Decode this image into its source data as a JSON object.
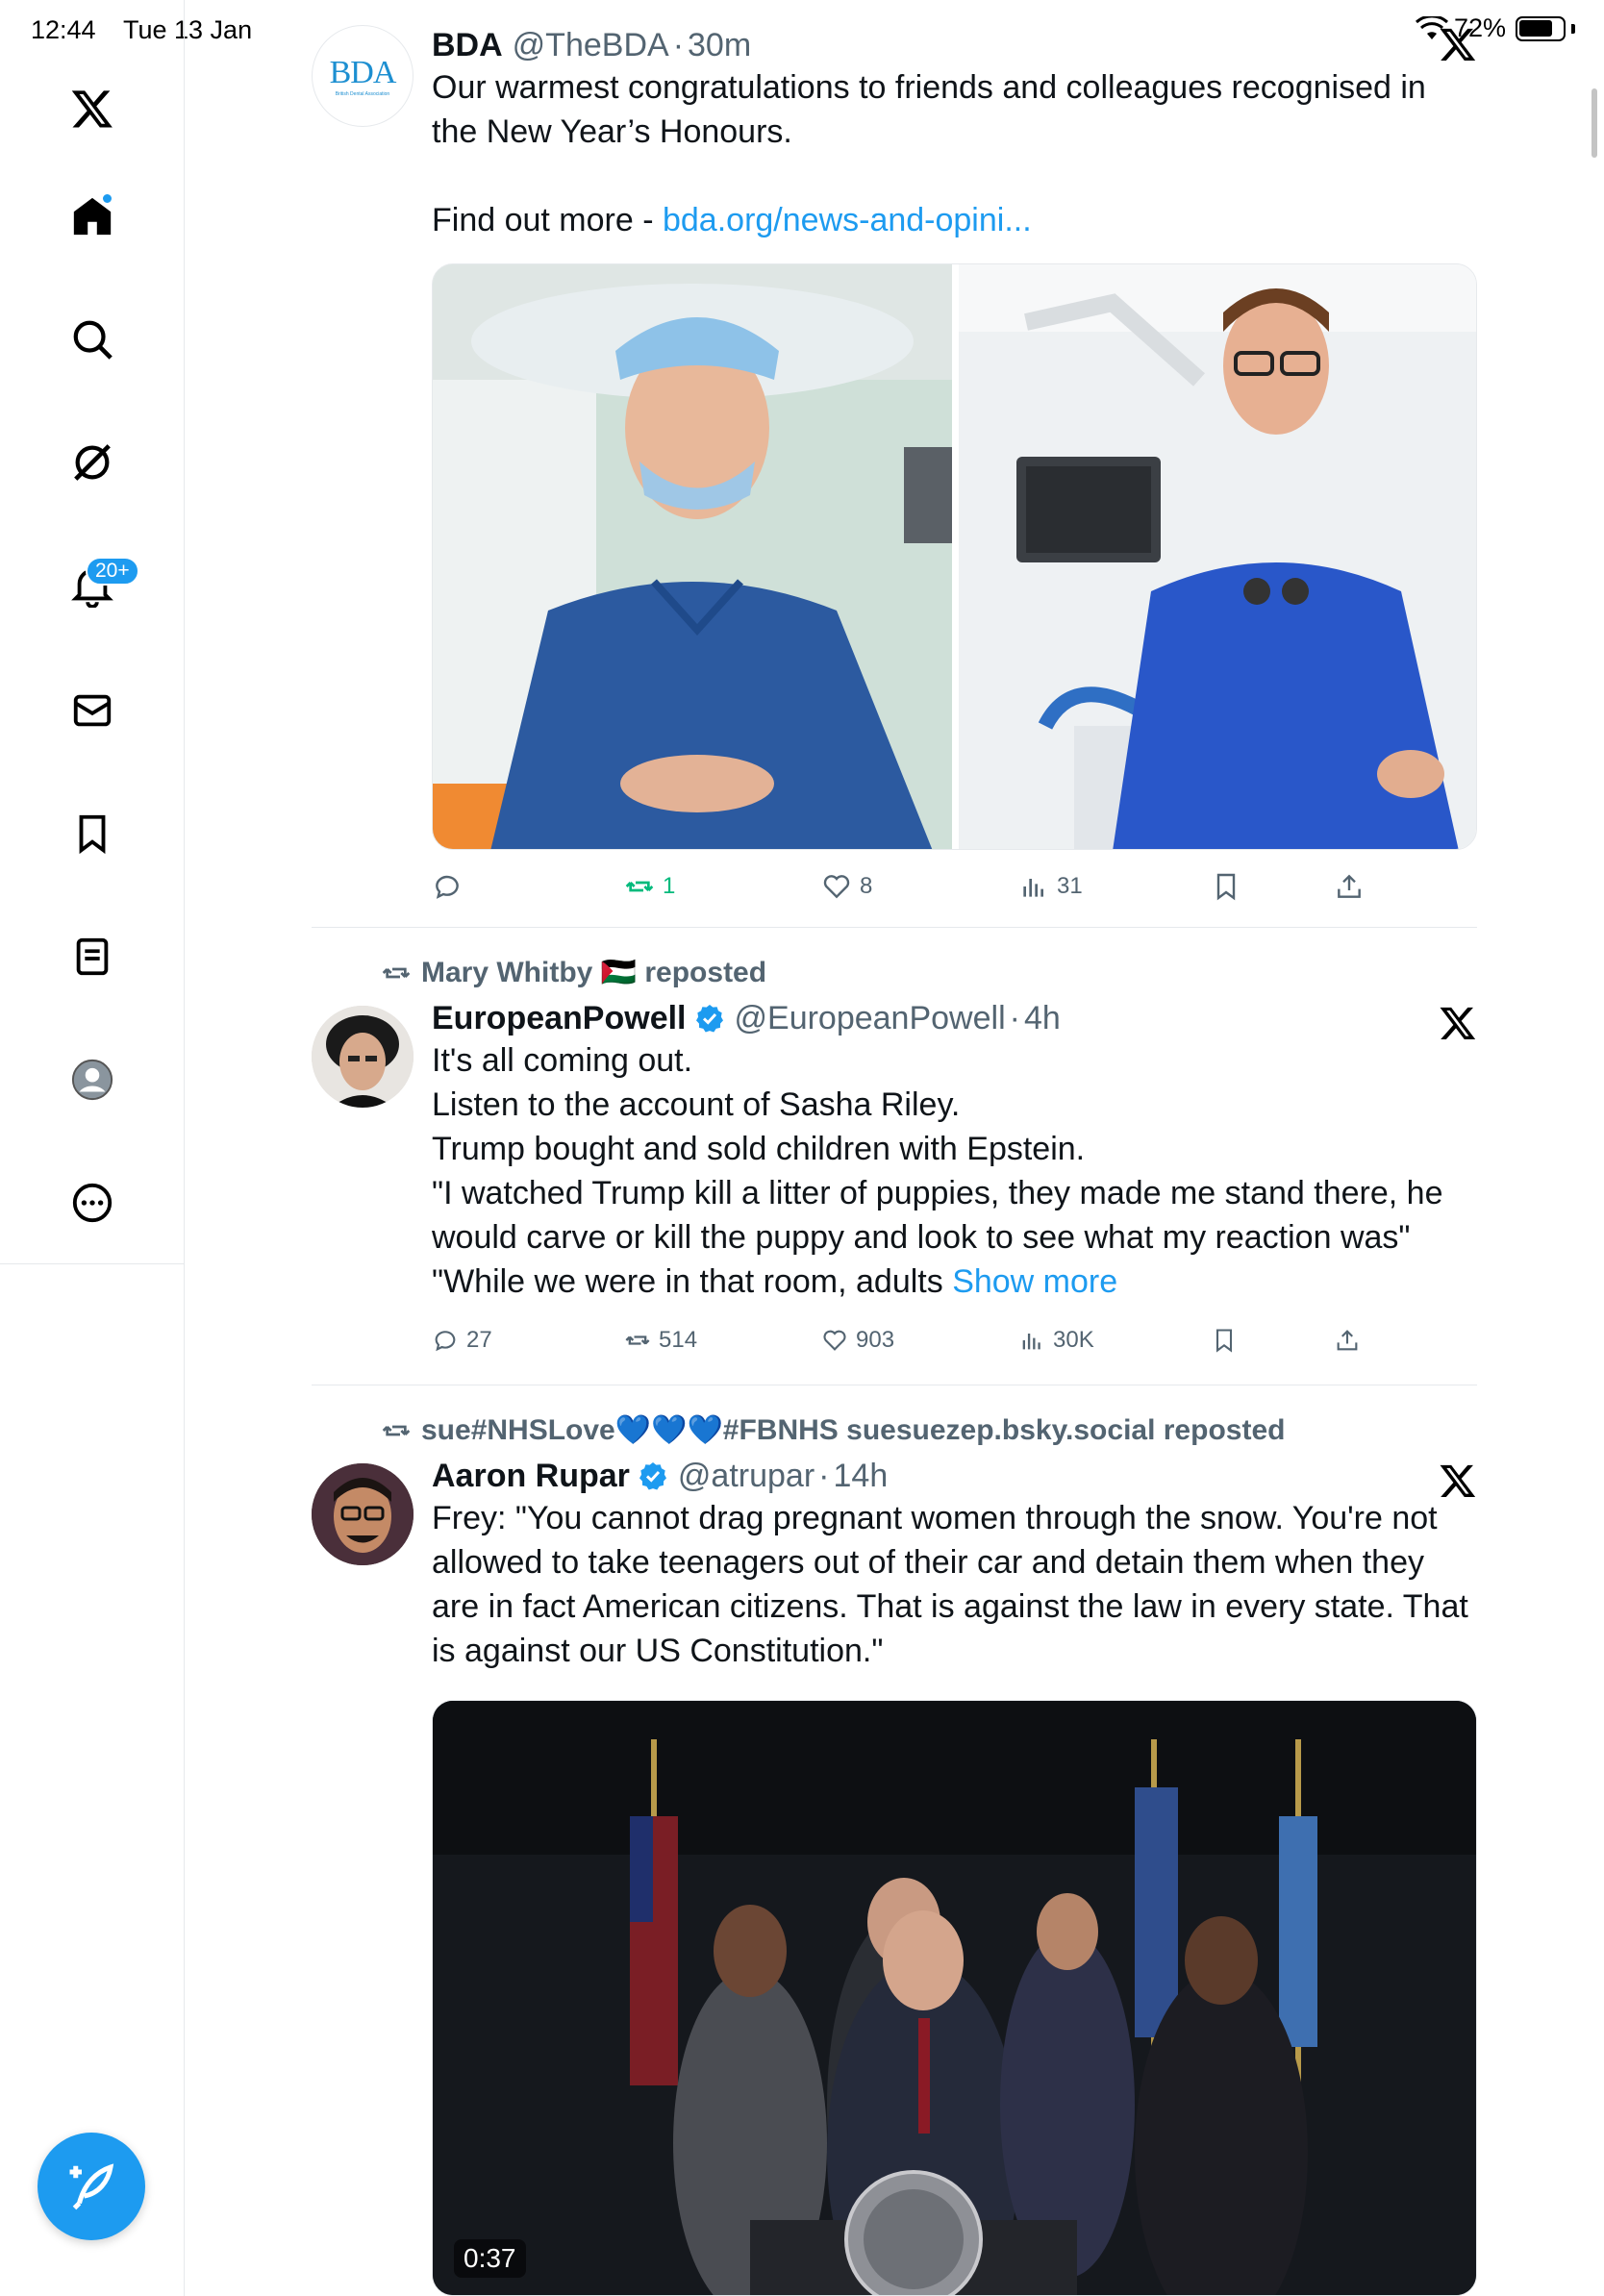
{
  "status_bar": {
    "time": "12:44",
    "date": "Tue 13 Jan",
    "battery": "72%"
  },
  "sidebar": {
    "notifications_badge": "20+",
    "items": [
      {
        "name": "x-logo-icon"
      },
      {
        "name": "home-icon"
      },
      {
        "name": "search-icon"
      },
      {
        "name": "grok-icon"
      },
      {
        "name": "notifications-icon"
      },
      {
        "name": "messages-icon"
      },
      {
        "name": "bookmarks-icon"
      },
      {
        "name": "lists-icon"
      },
      {
        "name": "profile-icon"
      },
      {
        "name": "more-icon"
      }
    ]
  },
  "tweets": [
    {
      "name": "BDA",
      "handle": "@TheBDA",
      "time": "30m",
      "avatar_text": "BDA",
      "avatar_subtext": "British Dental Association",
      "text_line1": "Our warmest congratulations to friends and colleagues recognised in the New Year’s Honours.",
      "text_line2_prefix": "Find out more - ",
      "link": "bda.org/news-and-opini...",
      "stats": {
        "reposts": "1",
        "likes": "8",
        "views": "31"
      }
    },
    {
      "reposted_by": "Mary Whitby 🇵🇸 reposted",
      "name": "EuropeanPowell",
      "handle": "@EuropeanPowell",
      "time": "4h",
      "lines": [
        "It's all coming out.",
        "Listen to the account of Sasha Riley.",
        "Trump bought and sold children with Epstein.",
        "\"I watched Trump kill a litter of puppies, they made me stand there, he would carve or kill the puppy and look to see what my reaction was\"",
        "\"While we were in that room, adults"
      ],
      "show_more": "Show more",
      "stats": {
        "replies": "27",
        "reposts": "514",
        "likes": "903",
        "views": "30K"
      }
    },
    {
      "reposted_by": "sue#NHSLove💙💙💙#FBNHS suesuezep.bsky.social reposted",
      "name": "Aaron Rupar",
      "handle": "@atrupar",
      "time": "14h",
      "text": "Frey: \"You cannot drag pregnant women through the snow. You're not allowed to take teenagers out of their car and detain them when they are in fact American citizens. That is against the law in every state. That is against our US Constitution.\"",
      "video_duration": "0:37"
    }
  ],
  "colors": {
    "accent": "#1d9bf0",
    "repost_active": "#00ba7c",
    "secondary_text": "#536471"
  }
}
